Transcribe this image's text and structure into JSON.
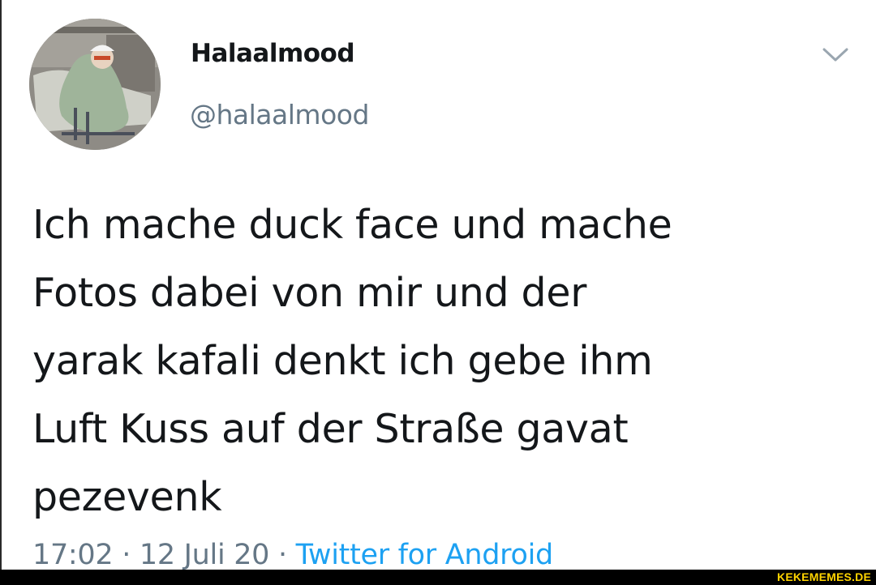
{
  "tweet": {
    "display_name": "Halaalmood",
    "handle": "@halaalmood",
    "text_lines": [
      "Ich mache duck face und mache",
      "Fotos dabei von mir und der",
      "yarak kafali denkt ich gebe ihm",
      "Luft Kuss auf der Straße gavat",
      "pezevenk"
    ],
    "time": "17:02",
    "separator": "·",
    "date": "12 Juli 20",
    "source": "Twitter for Android"
  },
  "icons": {
    "menu": "chevron-down-icon",
    "avatar": "avatar-image"
  },
  "colors": {
    "text": "#14171a",
    "secondary": "#657786",
    "link": "#1da1f2",
    "watermark": "#ffd400"
  },
  "watermark": {
    "text": "KEKEMEMES.DE"
  }
}
